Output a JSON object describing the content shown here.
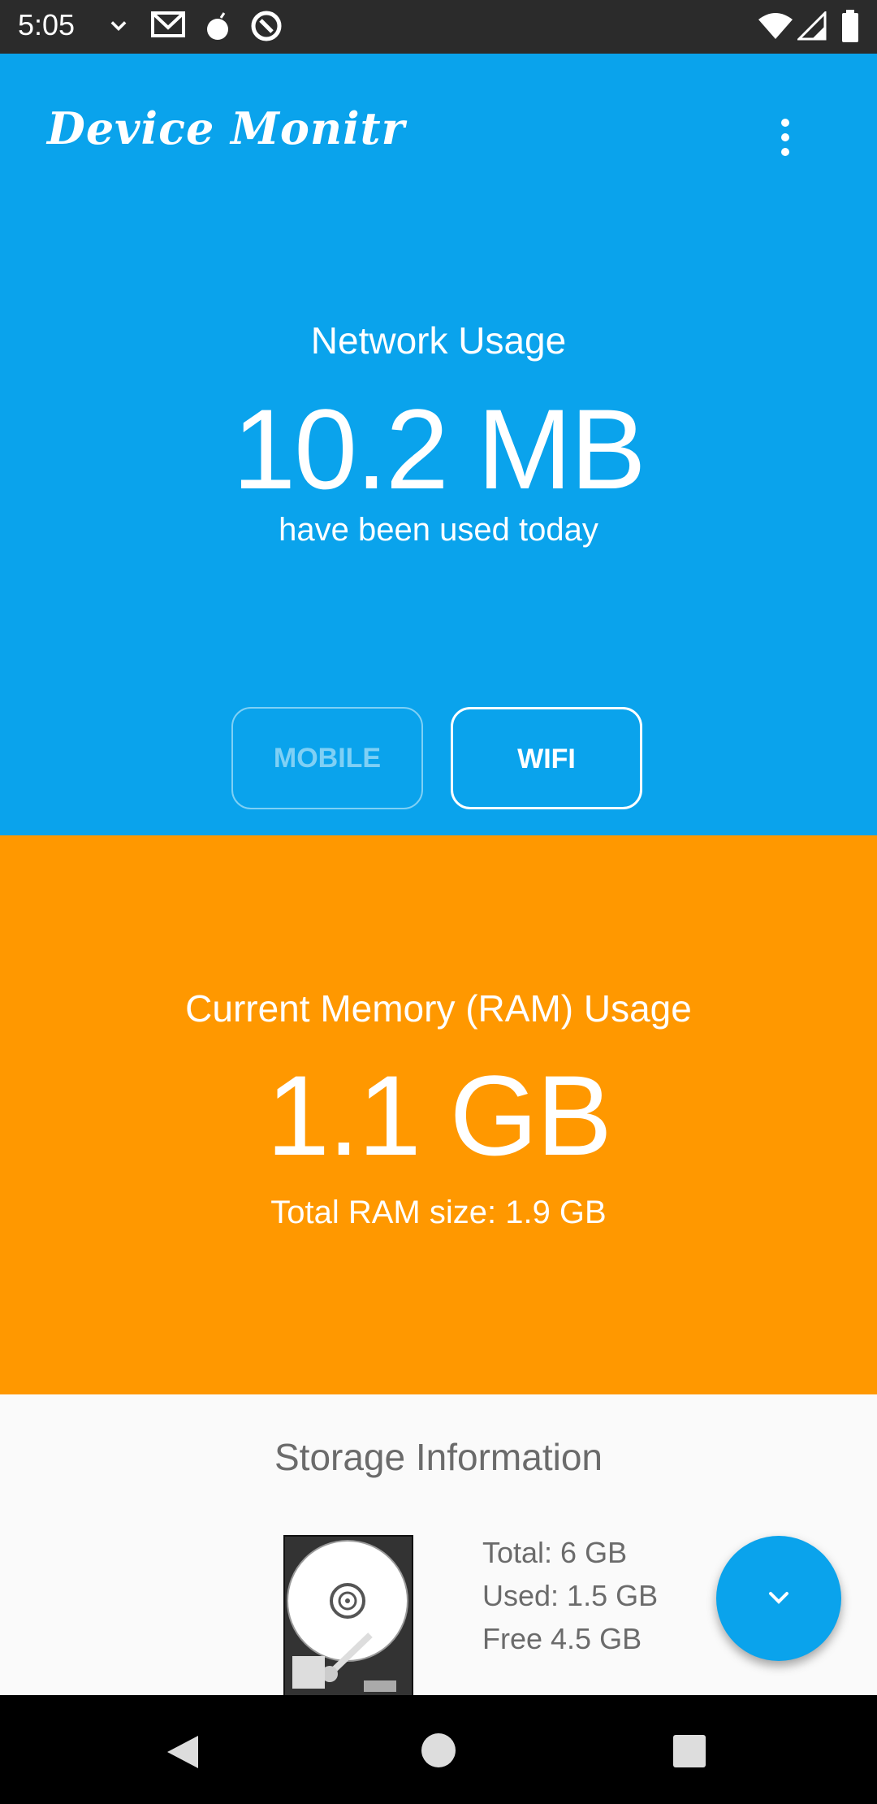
{
  "status_bar": {
    "time": "5:05",
    "icons": [
      "chevron-down-icon",
      "gmail-icon",
      "bomb-icon",
      "at-sign-icon",
      "wifi-icon",
      "signal-icon",
      "battery-icon"
    ]
  },
  "app_bar": {
    "title": "Device Monitr",
    "menu_icon": "more-vert-icon"
  },
  "network": {
    "title": "Network Usage",
    "value": "10.2 MB",
    "subtitle": "have been used today",
    "toggle": {
      "mobile_label": "MOBILE",
      "wifi_label": "WIFI",
      "selected": "WIFI"
    }
  },
  "memory": {
    "title": "Current Memory (RAM) Usage",
    "value": "1.1 GB",
    "subtitle": "Total RAM size: 1.9 GB"
  },
  "storage": {
    "title": "Storage Information",
    "total": "Total: 6 GB",
    "used": "Used: 1.5 GB",
    "free": "Free 4.5 GB",
    "image": "hard-drive-icon"
  },
  "fab": {
    "icon": "chevron-down-icon"
  },
  "nav_bar": {
    "icons": [
      "back-icon",
      "home-icon",
      "recents-icon"
    ]
  },
  "colors": {
    "network_bg": "#0aa3ec",
    "memory_bg": "#ff9800",
    "storage_bg": "#fafafa",
    "fab": "#0aa3ec"
  }
}
